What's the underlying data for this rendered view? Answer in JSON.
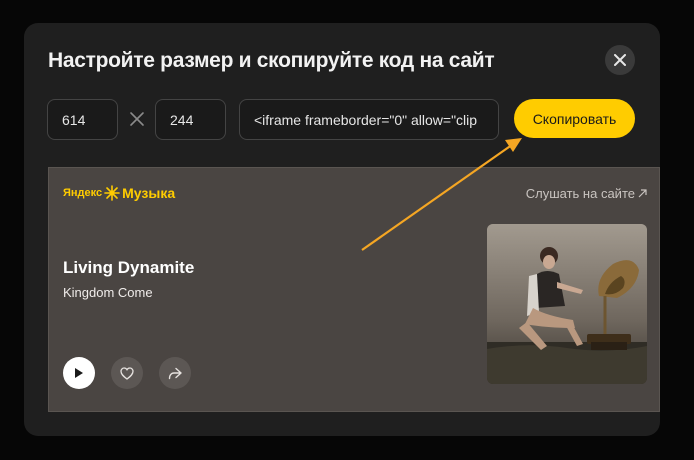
{
  "modal": {
    "title": "Настройте размер и скопируйте код на сайт",
    "width_value": "614",
    "height_value": "244",
    "code_value": "<iframe frameborder=\"0\" allow=\"clip",
    "copy_label": "Скопировать"
  },
  "player": {
    "logo_prefix": "Яндекс",
    "logo_name": "Музыка",
    "listen_label": "Слушать на сайте",
    "track_title": "Living Dynamite",
    "track_artist": "Kingdom Come"
  },
  "colors": {
    "accent": "#ffcc00",
    "annotation_arrow": "#f5a623"
  },
  "icons": [
    "close-icon",
    "times-icon",
    "external-link-icon",
    "play-icon",
    "heart-icon",
    "share-icon"
  ]
}
